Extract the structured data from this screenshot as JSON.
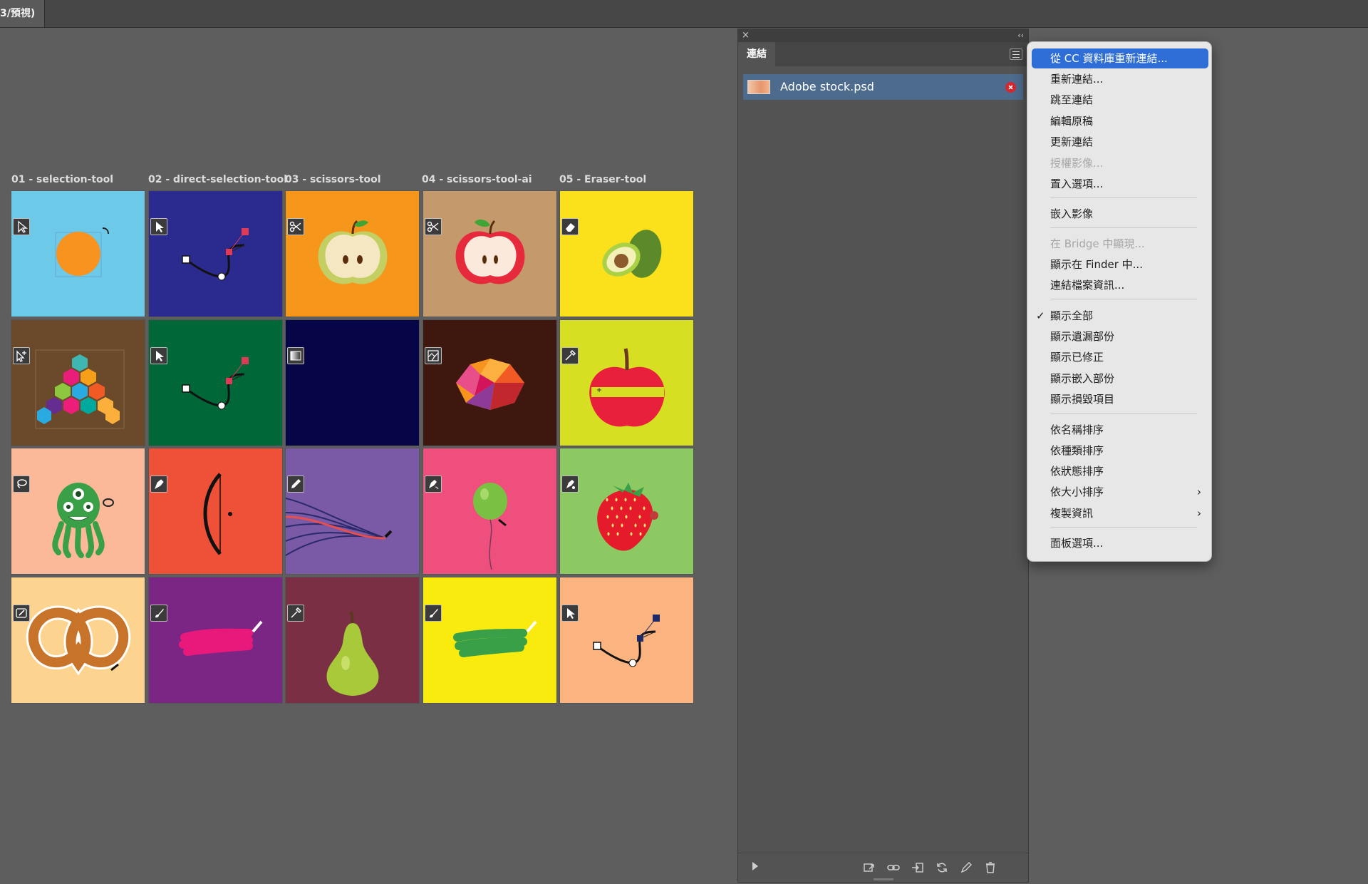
{
  "document_tab": {
    "title": "3/預視)"
  },
  "artboards": [
    {
      "label": "01 - selection-tool"
    },
    {
      "label": "02 - direct-selection-tool"
    },
    {
      "label": "03 - scissors-tool"
    },
    {
      "label": "04 - scissors-tool-ai"
    },
    {
      "label": "05 - Eraser-tool"
    }
  ],
  "tiles": [
    {
      "color": "#6cc9e8",
      "icon": "selection-arrow-icon",
      "art": "orange-circle"
    },
    {
      "color": "#2b2a8f",
      "icon": "direct-selection-icon",
      "art": "bezier-path"
    },
    {
      "color": "#f6961b",
      "icon": "scissors-icon",
      "art": "apple-half-green"
    },
    {
      "color": "#c49a6c",
      "icon": "scissors-icon",
      "art": "apple-half-red"
    },
    {
      "color": "#fbe01c",
      "icon": "eraser-icon",
      "art": "avocado"
    },
    {
      "color": "#6a4a2b",
      "icon": "artboard-tool-icon",
      "art": "hexagon-group"
    },
    {
      "color": "#006838",
      "icon": "direct-selection-icon",
      "art": "bezier-path"
    },
    {
      "color": "#050548",
      "icon": "gradient-icon",
      "art": "blank"
    },
    {
      "color": "#3e170e",
      "icon": "image-trace-icon",
      "art": "low-poly-gem"
    },
    {
      "color": "#d7df23",
      "icon": "eyedropper-icon",
      "art": "apple-red"
    },
    {
      "color": "#fbb99a",
      "icon": "lasso-icon",
      "art": "octopus"
    },
    {
      "color": "#ef5138",
      "icon": "pen-icon",
      "art": "bow"
    },
    {
      "color": "#7a5aa6",
      "icon": "pencil-icon",
      "art": "curves"
    },
    {
      "color": "#ee4f7d",
      "icon": "curvature-icon",
      "art": "balloon"
    },
    {
      "color": "#8cc963",
      "icon": "anchor-pen-icon",
      "art": "strawberry"
    },
    {
      "color": "#fdd48f",
      "icon": "shaper-icon",
      "art": "pretzel"
    },
    {
      "color": "#7b2585",
      "icon": "brush-icon",
      "art": "pink-stroke"
    },
    {
      "color": "#7a2f45",
      "icon": "eyedropper-icon",
      "art": "pear"
    },
    {
      "color": "#faeb0f",
      "icon": "brush-icon",
      "art": "green-stroke"
    },
    {
      "color": "#fbb37f",
      "icon": "direct-selection-icon",
      "art": "bezier-path-navy"
    }
  ],
  "links_panel": {
    "tab_label": "連結",
    "items": [
      {
        "name": "Adobe stock.psd",
        "status": "missing"
      }
    ]
  },
  "context_menu": {
    "items": [
      {
        "label": "從 CC 資料庫重新連結...",
        "state": "highlighted"
      },
      {
        "label": "重新連結..."
      },
      {
        "label": "跳至連結"
      },
      {
        "label": "編輯原稿"
      },
      {
        "label": "更新連結"
      },
      {
        "label": "授權影像...",
        "state": "disabled"
      },
      {
        "label": "置入選項..."
      },
      {
        "label": "嵌入影像"
      },
      {
        "label": "在 Bridge 中顯現...",
        "state": "disabled"
      },
      {
        "label": "顯示在 Finder 中..."
      },
      {
        "label": "連結檔案資訊..."
      },
      {
        "label": "顯示全部",
        "checked": true
      },
      {
        "label": "顯示遺漏部份"
      },
      {
        "label": "顯示已修正"
      },
      {
        "label": "顯示嵌入部份"
      },
      {
        "label": "顯示損毀項目"
      },
      {
        "label": "依名稱排序"
      },
      {
        "label": "依種類排序"
      },
      {
        "label": "依狀態排序"
      },
      {
        "label": "依大小排序",
        "submenu": true
      },
      {
        "label": "複製資訊",
        "submenu": true
      },
      {
        "label": "面板選項..."
      }
    ]
  },
  "colors": {
    "highlight": "#2e6ed6",
    "link_row": "#4d6b8c",
    "canvas": "#5e5e5e"
  }
}
